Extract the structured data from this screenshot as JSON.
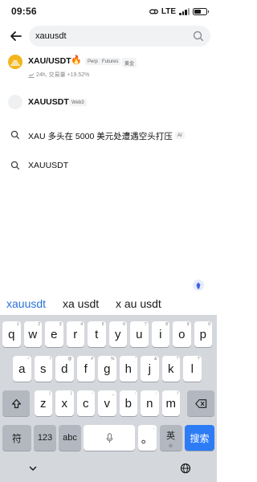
{
  "status": {
    "time": "09:56",
    "network": "LTE"
  },
  "search": {
    "value": "xauusdt"
  },
  "results": [
    {
      "name": "XAU/USDT",
      "emoji": "🔥",
      "tags": [
        "Perp",
        "Futures",
        "黄金"
      ],
      "sub": "24h, 交易量 +19.52%"
    },
    {
      "name": "XAUUSDT",
      "tags": [
        "Web3"
      ]
    },
    {
      "text": "XAU 多头在 5000 美元处遭遇空头打压",
      "badge": "AI"
    },
    {
      "text": "XAUUSDT"
    }
  ],
  "suggestions": [
    "xauusdt",
    "xa usdt",
    "x au usdt"
  ],
  "keyboard": {
    "row1": [
      {
        "k": "q",
        "h": "1"
      },
      {
        "k": "w",
        "h": "2"
      },
      {
        "k": "e",
        "h": "3"
      },
      {
        "k": "r",
        "h": "4"
      },
      {
        "k": "t",
        "h": "5"
      },
      {
        "k": "y",
        "h": "6"
      },
      {
        "k": "u",
        "h": "7"
      },
      {
        "k": "i",
        "h": "8"
      },
      {
        "k": "o",
        "h": "9"
      },
      {
        "k": "p",
        "h": "0"
      }
    ],
    "row2": [
      {
        "k": "a",
        "h": "~"
      },
      {
        "k": "s",
        "h": "!"
      },
      {
        "k": "d",
        "h": "@"
      },
      {
        "k": "f",
        "h": "#"
      },
      {
        "k": "g",
        "h": "%"
      },
      {
        "k": "h",
        "h": "'"
      },
      {
        "k": "j",
        "h": "&"
      },
      {
        "k": "k",
        "h": "*"
      },
      {
        "k": "l",
        "h": "?"
      }
    ],
    "row3": [
      {
        "k": "z",
        "h": "("
      },
      {
        "k": "x",
        "h": ")"
      },
      {
        "k": "c",
        "h": "-"
      },
      {
        "k": "v",
        "h": "_"
      },
      {
        "k": "b",
        "h": ":"
      },
      {
        "k": "n",
        "h": ";"
      },
      {
        "k": "m",
        "h": "/"
      }
    ],
    "symbol_label": "符",
    "number_label": "123",
    "abc_label": "abc",
    "punct_label": "。",
    "punct_hint": ",",
    "lang_label": "英",
    "lang_sub": "中",
    "search_label": "搜索"
  },
  "colors": {
    "accent": "#2d7cf6",
    "brand_gold": "#f3b51b",
    "suggestion_active": "#2a72d9"
  },
  "icons": {
    "back": "arrow-left-icon",
    "search": "search-icon",
    "shift": "shift-icon",
    "delete": "backspace-icon",
    "mic": "microphone-icon",
    "collapse": "chevron-down-icon",
    "globe": "globe-icon"
  }
}
